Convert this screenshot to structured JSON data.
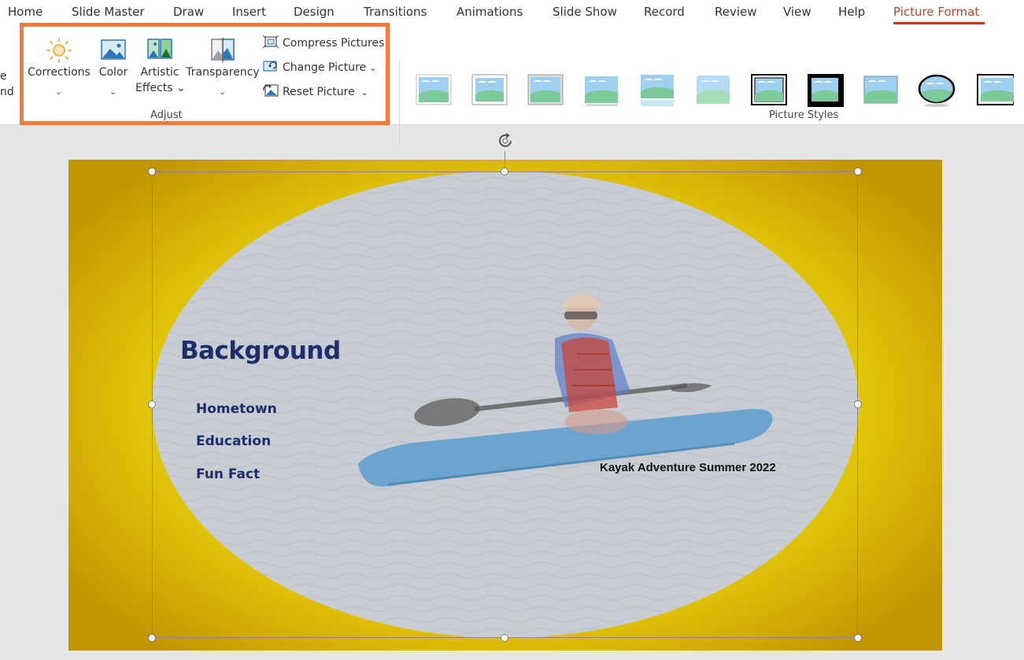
{
  "tabs": [
    {
      "label": "Home"
    },
    {
      "label": "Slide Master"
    },
    {
      "label": "Draw"
    },
    {
      "label": "Insert"
    },
    {
      "label": "Design"
    },
    {
      "label": "Transitions"
    },
    {
      "label": "Animations"
    },
    {
      "label": "Slide Show"
    },
    {
      "label": "Record"
    },
    {
      "label": "Review"
    },
    {
      "label": "View"
    },
    {
      "label": "Help"
    },
    {
      "label": "Picture Format"
    }
  ],
  "active_tab": "Picture Format",
  "ribbon": {
    "clipped_left": {
      "line1": "e",
      "line2": "nd"
    },
    "adjust": {
      "corrections": "Corrections",
      "color": "Color",
      "artistic_line1": "Artistic",
      "artistic_line2": "Effects",
      "transparency": "Transparency",
      "compress": "Compress Pictures",
      "change": "Change Picture",
      "reset": "Reset Picture",
      "group_label": "Adjust"
    },
    "picture_styles_label": "Picture Styles",
    "highlight_color": "#f47a3c"
  },
  "slide": {
    "title": "Background",
    "bullets": [
      "Hometown",
      "Education",
      "Fun Fact"
    ],
    "caption": "Kayak Adventure Summer 2022",
    "background_color": "#ecd80f",
    "text_color": "#1d2f6b"
  },
  "icons": [
    "sun-icon",
    "color-icon",
    "artistic-effects-icon",
    "transparency-icon",
    "compress-icon",
    "change-picture-icon",
    "reset-picture-icon",
    "rotate-handle-icon"
  ]
}
